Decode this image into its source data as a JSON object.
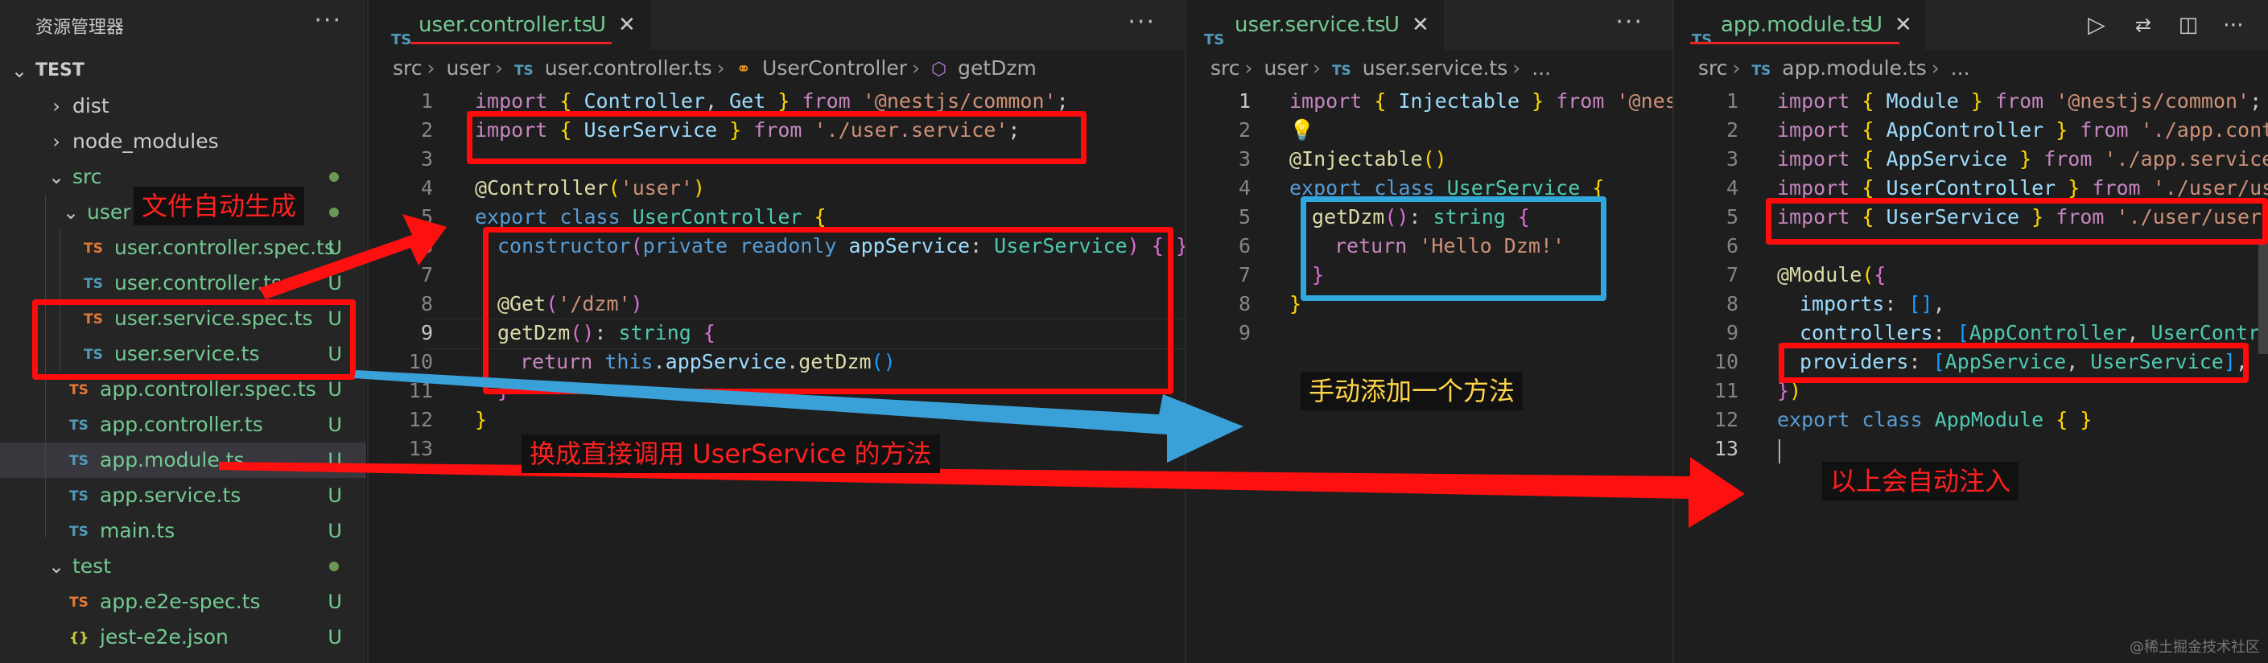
{
  "explorer": {
    "title": "资源管理器",
    "more": "···",
    "project": "TEST",
    "items": [
      {
        "name": "dist",
        "chev": "›",
        "color": "#cccccc",
        "badge": ""
      },
      {
        "name": "node_modules",
        "chev": "›",
        "color": "#cccccc",
        "badge": ""
      },
      {
        "name": "src",
        "chev": "⌄",
        "color": "#73c991",
        "badge": ""
      },
      {
        "name": "user",
        "chev": "⌄",
        "color": "#73c991",
        "badge": ""
      },
      {
        "name": "user.controller.spec.ts",
        "icon": "TS",
        "color": "#73c991",
        "badge": "U"
      },
      {
        "name": "user.controller.ts",
        "icon": "TS",
        "color": "#73c991",
        "badge": "U"
      },
      {
        "name": "user.service.spec.ts",
        "icon": "TS",
        "color": "#73c991",
        "badge": "U"
      },
      {
        "name": "user.service.ts",
        "icon": "TS",
        "color": "#73c991",
        "badge": "U"
      },
      {
        "name": "app.controller.spec.ts",
        "icon": "TS",
        "color": "#73c991",
        "badge": "U"
      },
      {
        "name": "app.controller.ts",
        "icon": "TS",
        "color": "#73c991",
        "badge": "U"
      },
      {
        "name": "app.module.ts",
        "icon": "TS",
        "color": "#73c991",
        "badge": "U"
      },
      {
        "name": "app.service.ts",
        "icon": "TS",
        "color": "#73c991",
        "badge": "U"
      },
      {
        "name": "main.ts",
        "icon": "TS",
        "color": "#73c991",
        "badge": "U"
      },
      {
        "name": "test",
        "chev": "⌄",
        "color": "#73c991",
        "badge": ""
      },
      {
        "name": "app.e2e-spec.ts",
        "icon": "TS",
        "color": "#73c991",
        "badge": "U"
      },
      {
        "name": "jest-e2e.json",
        "icon": "{}",
        "color": "#73c991",
        "badge": "U"
      }
    ]
  },
  "editors": [
    {
      "tab": {
        "icon": "TS",
        "name": "user.controller.ts",
        "status": "U",
        "close": "✕"
      },
      "more": "···",
      "breadcrumb": [
        "src",
        "user",
        "user.controller.ts",
        "UserController",
        "getDzm"
      ],
      "line_numbers": [
        "1",
        "2",
        "3",
        "4",
        "5",
        "6",
        "7",
        "8",
        "9",
        "10",
        "11",
        "12",
        "13"
      ],
      "active_line": "9"
    },
    {
      "tab": {
        "icon": "TS",
        "name": "user.service.ts",
        "status": "U",
        "close": "✕"
      },
      "more": "···",
      "breadcrumb": [
        "src",
        "user",
        "user.service.ts",
        "..."
      ],
      "line_numbers": [
        "1",
        "2",
        "3",
        "4",
        "5",
        "6",
        "7",
        "8",
        "9"
      ],
      "active_line": "1"
    },
    {
      "tab": {
        "icon": "TS",
        "name": "app.module.ts",
        "status": "U",
        "close": "✕"
      },
      "breadcrumb": [
        "src",
        "app.module.ts",
        "..."
      ],
      "line_numbers": [
        "1",
        "2",
        "3",
        "4",
        "5",
        "6",
        "7",
        "8",
        "9",
        "10",
        "11",
        "12",
        "13"
      ],
      "active_line": "13"
    }
  ],
  "annotations": {
    "auto_generated": "文件自动生成",
    "switch_call": "换成直接调用 UserService 的方法",
    "manual_add": "手动添加一个方法",
    "auto_inject": "以上会自动注入"
  },
  "watermark": "@稀土掘金技术社区",
  "colors": {
    "annotation_red": "#ff0b0b",
    "annotation_blue": "#30a8de",
    "git_untracked": "#73c991",
    "ts_icon": "#519aba"
  }
}
